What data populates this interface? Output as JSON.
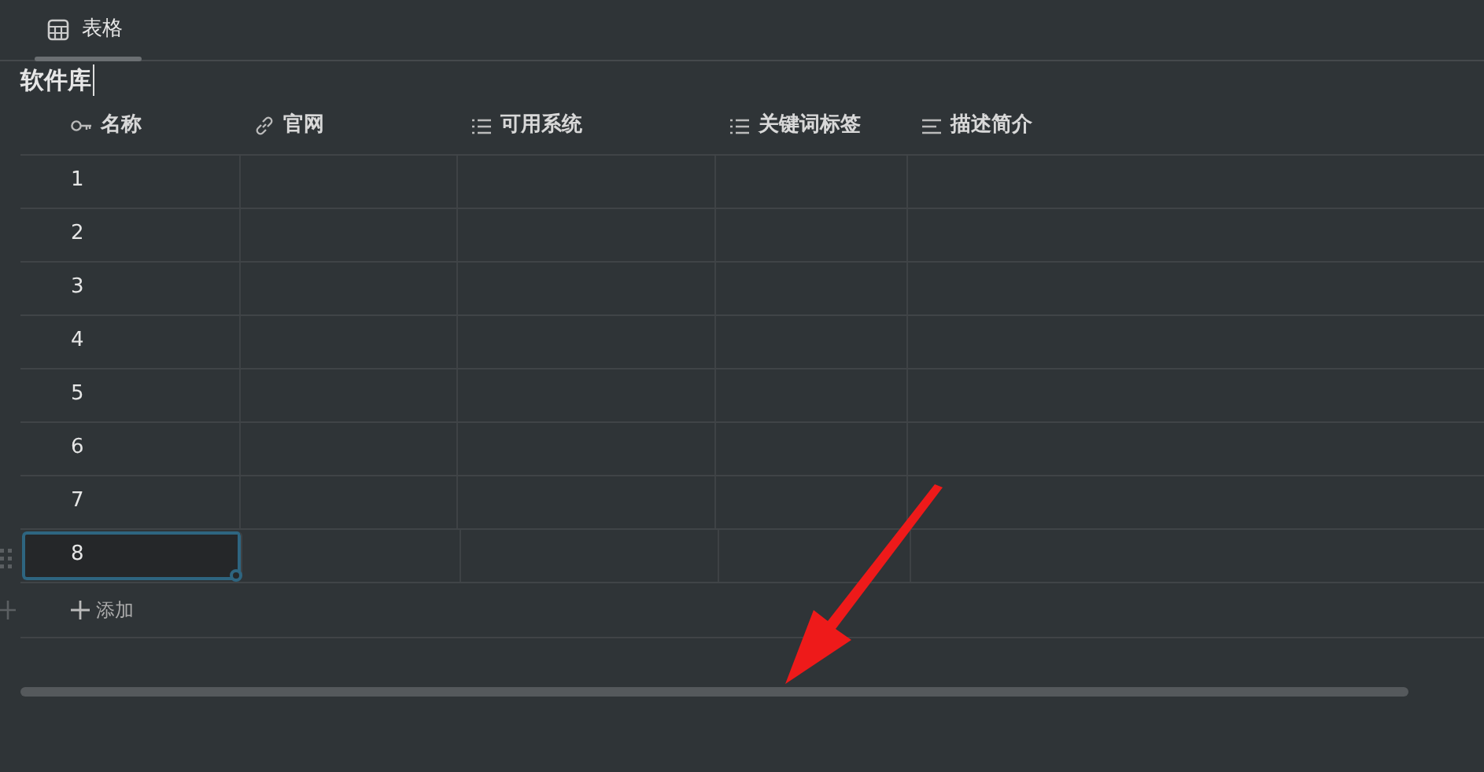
{
  "tabs": [
    {
      "label": "表格",
      "selected": true
    }
  ],
  "title": "软件库",
  "table": {
    "columns": [
      {
        "label": "名称",
        "kind": "key"
      },
      {
        "label": "官网",
        "kind": "link"
      },
      {
        "label": "可用系统",
        "kind": "list"
      },
      {
        "label": "关键词标签",
        "kind": "list"
      },
      {
        "label": "描述简介",
        "kind": "text"
      }
    ],
    "rows": [
      {
        "name": "1",
        "selected": false
      },
      {
        "name": "2",
        "selected": false
      },
      {
        "name": "3",
        "selected": false
      },
      {
        "name": "4",
        "selected": false
      },
      {
        "name": "5",
        "selected": false
      },
      {
        "name": "6",
        "selected": false
      },
      {
        "name": "7",
        "selected": false
      },
      {
        "name": "8",
        "selected": true
      }
    ]
  },
  "add_button": "添加"
}
